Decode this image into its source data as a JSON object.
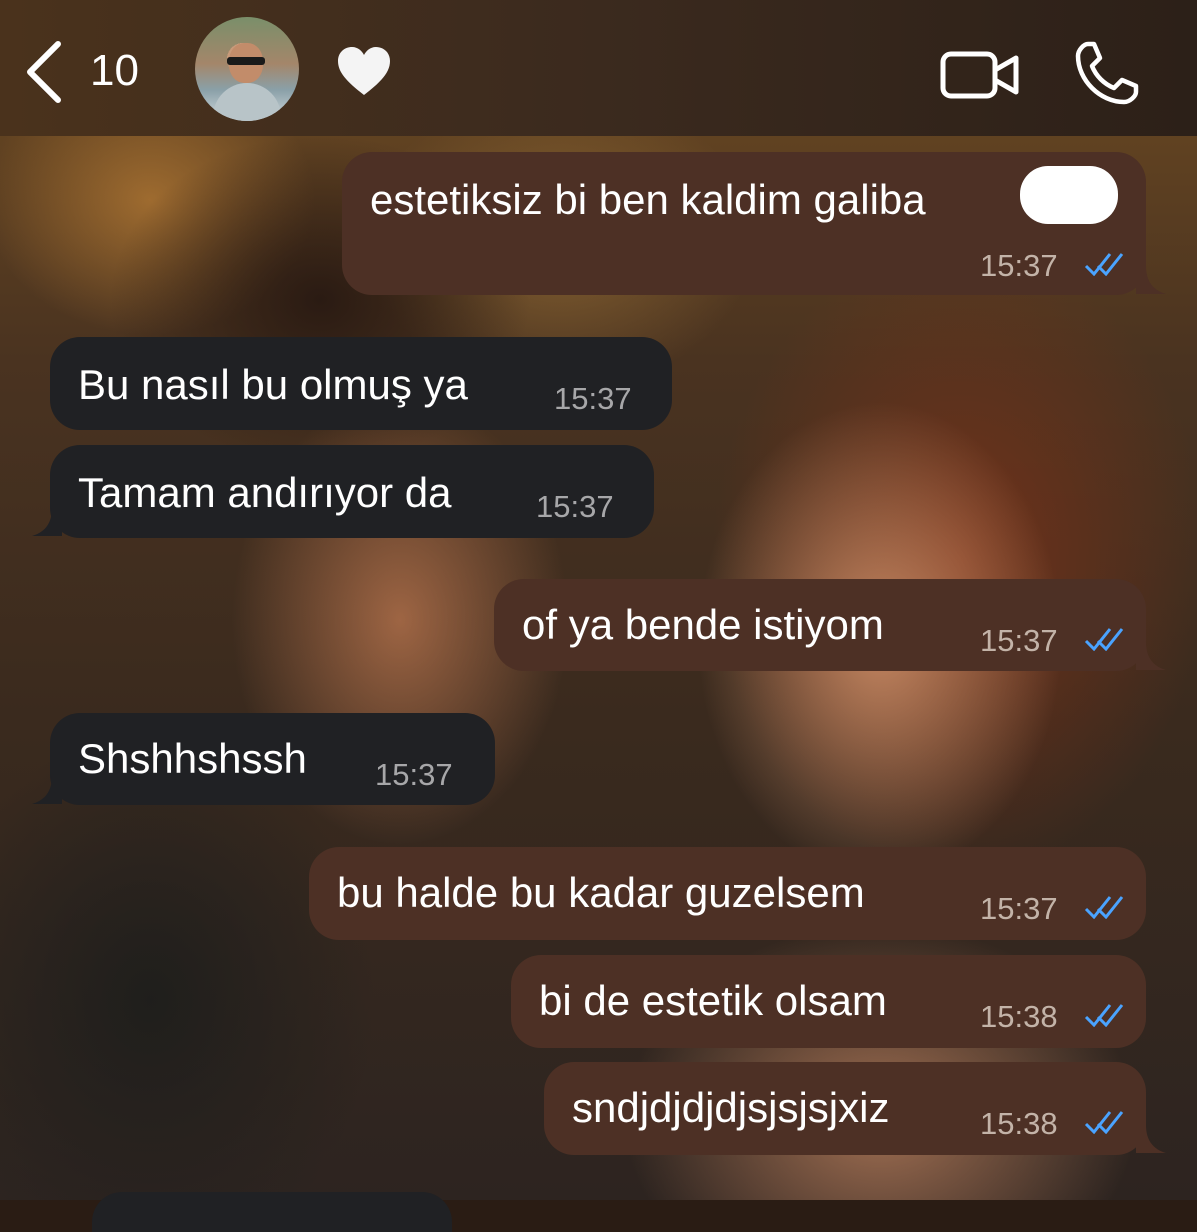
{
  "header": {
    "back_count": "10",
    "avatar_icon": "contact-avatar",
    "heart_icon": "white-heart-icon",
    "video_icon": "video-call-icon",
    "call_icon": "phone-icon"
  },
  "messages": [
    {
      "direction": "out",
      "text": "estetiksiz bi ben kaldim galiba",
      "time": "15:37",
      "read": true
    },
    {
      "direction": "in",
      "text": "Bu nasıl bu olmuş ya",
      "time": "15:37"
    },
    {
      "direction": "in",
      "text": "Tamam andırıyor da",
      "time": "15:37"
    },
    {
      "direction": "out",
      "text": "of ya bende istiyom",
      "time": "15:37",
      "read": true
    },
    {
      "direction": "in",
      "text": "Shshhshssh",
      "time": "15:37"
    },
    {
      "direction": "out",
      "text": "bu halde bu kadar guzelsem",
      "time": "15:37",
      "read": true
    },
    {
      "direction": "out",
      "text": "bi de estetik olsam",
      "time": "15:38",
      "read": true
    },
    {
      "direction": "out",
      "text": "sndjdjdjdjsjsjsjxiz",
      "time": "15:38",
      "read": true
    }
  ],
  "colors": {
    "outgoing_bubble": "#4d3025",
    "incoming_bubble": "#202124",
    "read_tick": "#4aa3ff"
  }
}
